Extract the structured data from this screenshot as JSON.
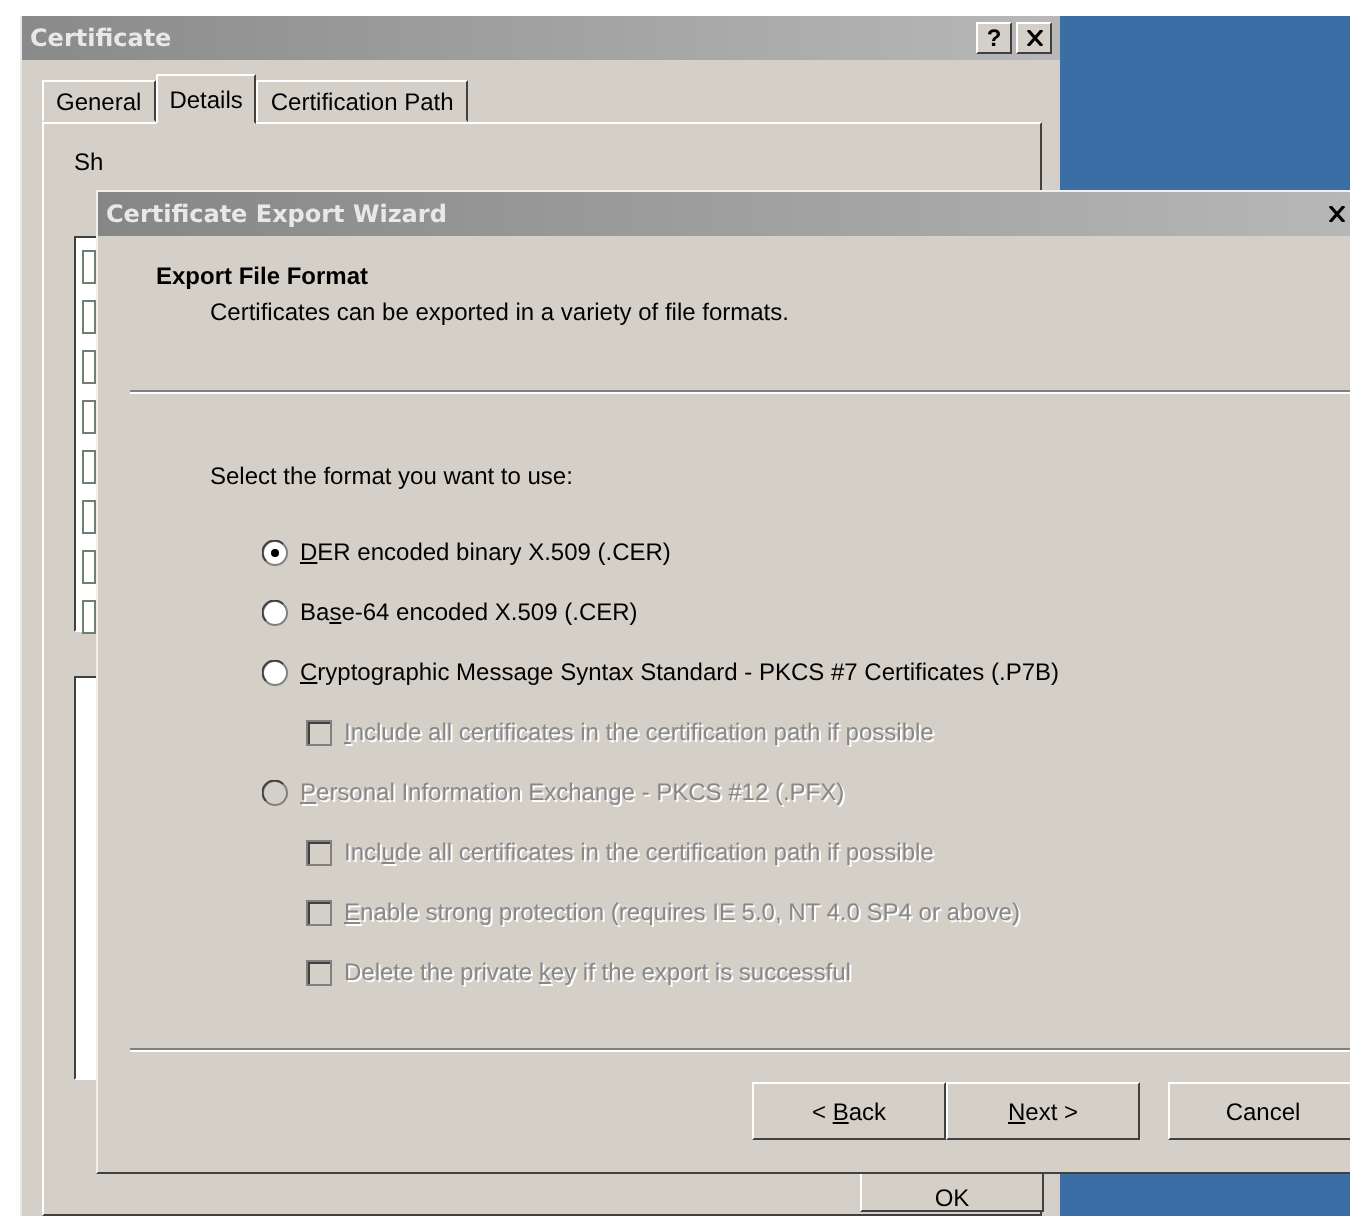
{
  "certificate_window": {
    "title": "Certificate",
    "help_button": "?",
    "tabs": [
      {
        "label": "General",
        "selected": false
      },
      {
        "label": "Details",
        "selected": true
      },
      {
        "label": "Certification Path",
        "selected": false
      }
    ],
    "show_label": "Sh",
    "ok_button": "OK"
  },
  "wizard": {
    "title": "Certificate Export Wizard",
    "heading": "Export File Format",
    "subtitle": "Certificates can be exported in a variety of file formats.",
    "prompt": "Select the format you want to use:",
    "options": [
      {
        "kind": "radio",
        "key": "D",
        "post": "ER encoded binary X.509 (.CER)",
        "selected": true,
        "disabled": false
      },
      {
        "kind": "radio",
        "pre": "Ba",
        "key": "s",
        "post": "e-64 encoded X.509 (.CER)",
        "selected": false,
        "disabled": false
      },
      {
        "kind": "radio",
        "key": "C",
        "post": "ryptographic Message Syntax Standard - PKCS #7 Certificates (.P7B)",
        "selected": false,
        "disabled": false
      },
      {
        "kind": "checkbox",
        "key": "I",
        "post": "nclude all certificates in the certification path if possible",
        "checked": false,
        "disabled": true
      },
      {
        "kind": "radio",
        "key": "P",
        "post": "ersonal Information Exchange - PKCS #12 (.PFX)",
        "selected": false,
        "disabled": true
      },
      {
        "kind": "checkbox",
        "pre": "Incl",
        "key": "u",
        "post": "de all certificates in the certification path if possible",
        "checked": false,
        "disabled": true
      },
      {
        "kind": "checkbox",
        "key": "E",
        "post": "nable strong protection (requires IE 5.0, NT 4.0 SP4 or above)",
        "checked": false,
        "disabled": true
      },
      {
        "kind": "checkbox",
        "pre": "Delete the private ",
        "key": "k",
        "post": "ey if the export is successful",
        "checked": false,
        "disabled": true
      }
    ],
    "buttons": [
      {
        "pre": "< ",
        "key": "B",
        "post": "ack"
      },
      {
        "key": "N",
        "post": "ext >"
      },
      {
        "pre": "Cancel"
      }
    ]
  }
}
